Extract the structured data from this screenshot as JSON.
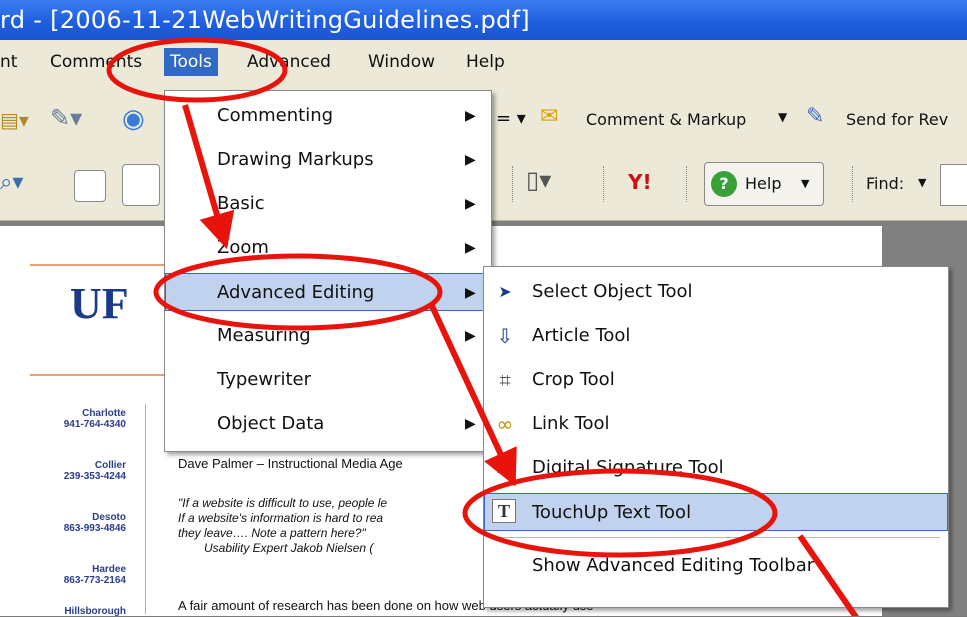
{
  "window": {
    "title": "rd - [2006-11-21WebWritingGuidelines.pdf]"
  },
  "menubar": {
    "items": [
      "nt",
      "Comments",
      "Tools",
      "Advanced",
      "Window",
      "Help"
    ]
  },
  "toolbar": {
    "comment_markup": "Comment & Markup",
    "send_for_review": "Send for Rev",
    "help": "Help",
    "find": "Find:"
  },
  "tools_menu": {
    "items": [
      {
        "label": "Commenting",
        "submenu": true
      },
      {
        "label": "Drawing Markups",
        "submenu": true
      },
      {
        "label": "Basic",
        "submenu": true
      },
      {
        "label": "Zoom",
        "submenu": true
      },
      {
        "label": "Advanced Editing",
        "submenu": true
      },
      {
        "label": "Measuring",
        "submenu": true
      },
      {
        "label": "Typewriter",
        "submenu": false
      },
      {
        "label": "Object Data",
        "submenu": true
      }
    ],
    "highlighted": "Advanced Editing"
  },
  "advanced_editing_menu": {
    "items": [
      {
        "label": "Select Object Tool",
        "icon": "arrow-cursor-icon"
      },
      {
        "label": "Article Tool",
        "icon": "article-icon"
      },
      {
        "label": "Crop Tool",
        "icon": "crop-icon"
      },
      {
        "label": "Link Tool",
        "icon": "link-icon"
      },
      {
        "label": "Digital Signature Tool",
        "icon": "signature-icon"
      },
      {
        "label": "TouchUp Text Tool",
        "icon": "touchup-text-icon"
      },
      {
        "label": "Show Advanced Editing Toolbar",
        "icon": ""
      }
    ],
    "highlighted": "TouchUp Text Tool"
  },
  "document": {
    "logo": "UF",
    "sidebar": [
      {
        "city": "Charlotte",
        "phone": "941-764-4340"
      },
      {
        "city": "Collier",
        "phone": "239-353-4244"
      },
      {
        "city": "Desoto",
        "phone": "863-993-4846"
      },
      {
        "city": "Hardee",
        "phone": "863-773-2164"
      },
      {
        "city": "Hillsborough",
        "phone": ""
      }
    ],
    "author_line": "Dave Palmer – Instructional Media Age",
    "quote_line1": "\"If a website is difficult to use, people le",
    "quote_line2": "If a website's information is hard to rea",
    "quote_line3": "they leave….  Note a pattern here?\"",
    "quote_attrib": "Usability Expert Jakob Nielsen (",
    "body_line": "A fair amount of research has been done on how web users actually use"
  },
  "colors": {
    "title_bar": "#1f5fe0",
    "menu_highlight": "#316ac5",
    "item_highlight": "#c1d2ee",
    "annotation_red": "#e8140c"
  }
}
